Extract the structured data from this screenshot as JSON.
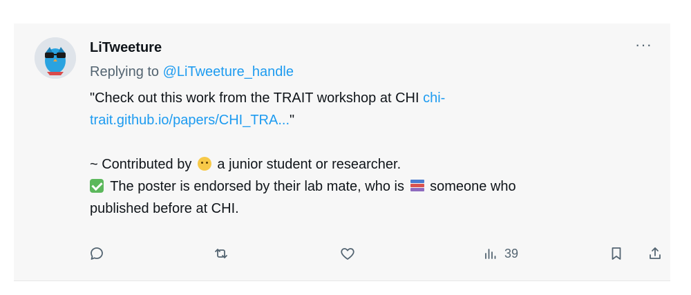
{
  "tweet": {
    "author_name": "LiTweeture",
    "replying_prefix": "Replying to ",
    "replying_handle": "@LiTweeture_handle",
    "text_quote_open": "\"Check out this work from the TRAIT workshop at CHI ",
    "link_part1": "chi-",
    "link_part2": "trait.github.io/papers/CHI_TRA...",
    "text_quote_close": "\"",
    "contrib_prefix": "~ Contributed by ",
    "contrib_suffix": " a junior student or researcher.",
    "endorse_prefix": " The poster is endorsed by their lab mate, who is ",
    "endorse_suffix": " someone who",
    "endorse_line2": "published before at  CHI.",
    "more_label": "···"
  },
  "icons": {
    "avatar": "owl-with-glasses-avatar",
    "face": "baby-face-emoji",
    "check": "check-mark-button-emoji",
    "books": "books-emoji",
    "reply": "reply-icon",
    "retweet": "retweet-icon",
    "like": "heart-icon",
    "views": "analytics-icon",
    "bookmark": "bookmark-icon",
    "share": "share-icon"
  },
  "actions": {
    "views_count": "39"
  },
  "colors": {
    "link": "#1d9bf0",
    "muted": "#536471",
    "card_bg": "#f7f7f7"
  }
}
